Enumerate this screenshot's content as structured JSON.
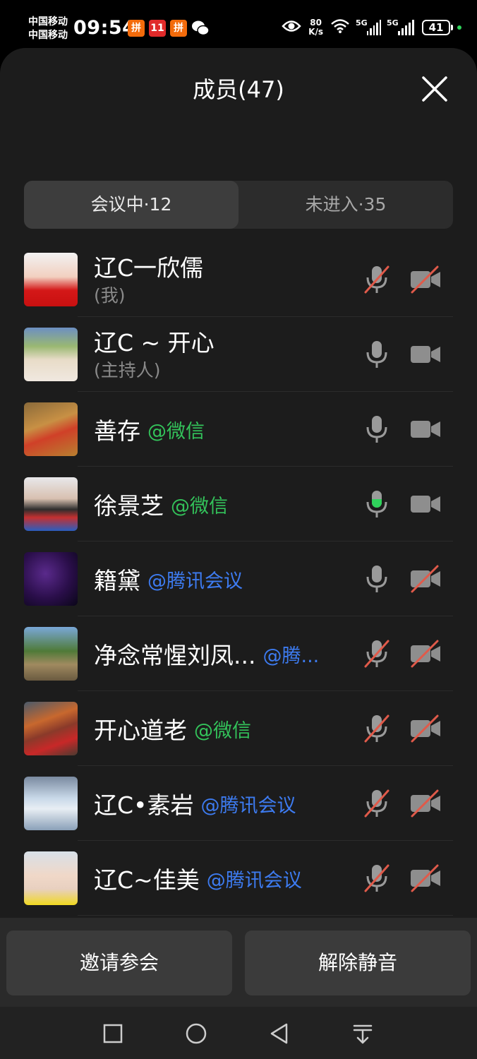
{
  "status_bar": {
    "carrier_1": "中国移动",
    "carrier_2": "中国移动",
    "time": "09:54",
    "app_badges": [
      "拼",
      "11",
      "拼"
    ],
    "net_speed_value": "80",
    "net_speed_unit": "K/s",
    "network_1": "5G",
    "network_2": "5G",
    "battery": "41"
  },
  "header": {
    "title": "成员(47)"
  },
  "tabs": [
    {
      "label": "会议中·12",
      "active": true
    },
    {
      "label": "未进入·35",
      "active": false
    }
  ],
  "members": [
    {
      "name": "辽C一欣儒",
      "sub": "(我)",
      "tag": "",
      "mic": "muted",
      "cam": "off"
    },
    {
      "name": "辽C ~ 开心",
      "sub": "(主持人)",
      "tag": "",
      "mic": "on",
      "cam": "on"
    },
    {
      "name": "善存",
      "sub": "",
      "tag": "@微信",
      "mic": "on",
      "cam": "on"
    },
    {
      "name": "徐景芝",
      "sub": "",
      "tag": "@微信",
      "mic": "speaking",
      "cam": "on"
    },
    {
      "name": "籍黛",
      "sub": "",
      "tag": "@腾讯会议",
      "mic": "on",
      "cam": "off"
    },
    {
      "name": "净念常惺刘凤...",
      "sub": "",
      "tag": "@腾...",
      "mic": "muted",
      "cam": "off"
    },
    {
      "name": "开心道老",
      "sub": "",
      "tag": "@微信",
      "mic": "muted",
      "cam": "off"
    },
    {
      "name": "辽C•素岩",
      "sub": "",
      "tag": "@腾讯会议",
      "mic": "muted",
      "cam": "off"
    },
    {
      "name": "辽C~佳美",
      "sub": "",
      "tag": "@腾讯会议",
      "mic": "muted",
      "cam": "off"
    }
  ],
  "actions": {
    "invite": "邀请参会",
    "unmute": "解除静音"
  },
  "nav": [
    "square-icon",
    "circle-icon",
    "back-triangle-icon",
    "notification-pulldown-icon"
  ],
  "colors": {
    "wechat_tag": "#33c25a",
    "tencent_tag": "#3d7bf0",
    "speaking": "#2fd35b",
    "muted_slash": "#e05a4a"
  }
}
